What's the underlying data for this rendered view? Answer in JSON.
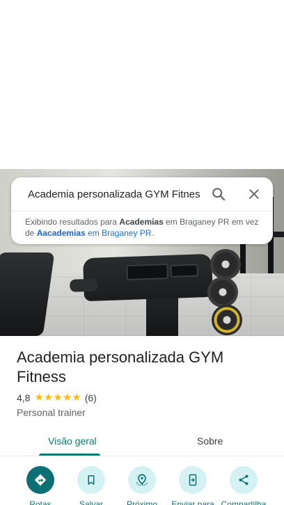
{
  "search": {
    "query": "Academia personalizada GYM Fitnes",
    "note_prefix": "Exibindo resultados para ",
    "note_term": "Academias",
    "note_middle": " em Braganey PR em vez de ",
    "note_original_term": "Aacademias",
    "note_original_suffix": " em Braganey PR",
    "note_end": "."
  },
  "place": {
    "title": "Academia personalizada GYM Fitness",
    "rating": "4,8",
    "stars": 5,
    "review_count": "(6)",
    "category": "Personal trainer"
  },
  "tabs": [
    {
      "label": "Visão geral",
      "active": true
    },
    {
      "label": "Sobre",
      "active": false
    }
  ],
  "actions": [
    {
      "label": "Rotas",
      "icon": "directions-icon"
    },
    {
      "label": "Salvar",
      "icon": "bookmark-icon"
    },
    {
      "label": "Próximo",
      "icon": "nearby-icon"
    },
    {
      "label": "Enviar para",
      "icon": "send-to-phone-icon"
    },
    {
      "label": "Compartilha",
      "icon": "share-icon"
    }
  ],
  "colors": {
    "accent": "#0b7a75",
    "action_circle": "#d4f1f4",
    "action_primary": "#0b6f74",
    "star": "#fbbc04",
    "link": "#1a73e8"
  }
}
